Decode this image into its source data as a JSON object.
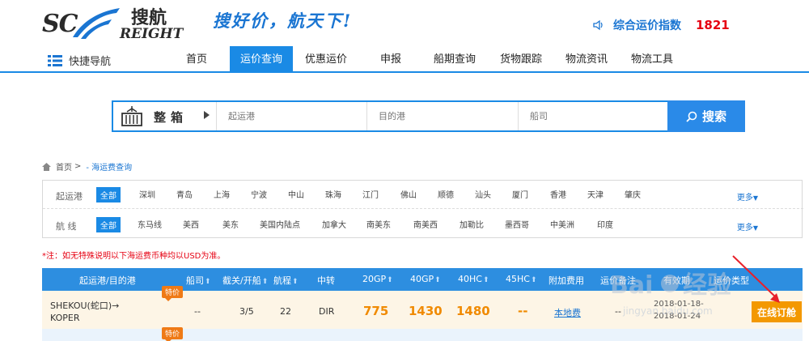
{
  "header": {
    "logo_main": "SC",
    "logo_cn": "搜航",
    "logo_sub": "REIGHT",
    "slogan": "搜好价，航天下!",
    "index_label": "综合运价指数",
    "index_value": "1821"
  },
  "nav": {
    "quick": "快捷导航",
    "items": [
      "首页",
      "运价查询",
      "优惠运价",
      "申报",
      "船期查询",
      "货物跟踪",
      "物流资讯",
      "物流工具"
    ],
    "active_index": 1
  },
  "search": {
    "type_label": "整箱",
    "origin_placeholder": "起运港",
    "dest_placeholder": "目的港",
    "carrier_placeholder": "船司",
    "button_label": "搜索"
  },
  "breadcrumb": {
    "home": "首页",
    "sep": ">",
    "current": "- 海运费查询"
  },
  "filters": {
    "origin": {
      "title": "起运港",
      "options": [
        "全部",
        "深圳",
        "青岛",
        "上海",
        "宁波",
        "中山",
        "珠海",
        "江门",
        "佛山",
        "顺德",
        "汕头",
        "厦门",
        "香港",
        "天津",
        "肇庆"
      ],
      "more": "更多"
    },
    "route": {
      "title": "航 线",
      "options": [
        "全部",
        "东马线",
        "美西",
        "美东",
        "美国内陆点",
        "加拿大",
        "南美东",
        "南美西",
        "加勒比",
        "墨西哥",
        "中美洲",
        "印度"
      ],
      "more": "更多"
    }
  },
  "note": "*注：如无特殊说明以下海运费币种均以USD为准。",
  "table": {
    "headers": [
      "起运港/目的港",
      "船司",
      "截关/开船",
      "航程",
      "中转",
      "20GP",
      "40GP",
      "40HC",
      "45HC",
      "附加费用",
      "运价备注",
      "有效期",
      "运价类型"
    ],
    "rows": [
      {
        "route_from": "SHEKOU(蛇口)→",
        "route_to": "KOPER",
        "tag": "特价",
        "carrier": "--",
        "cutoff": "3/5",
        "transit": "22",
        "via": "DIR",
        "gp20": "775",
        "gp40": "1430",
        "hc40": "1480",
        "hc45": "--",
        "surcharge": "本地费",
        "remark": "--",
        "valid_from": "2018-01-18-",
        "valid_to": "2018-01-24",
        "action": "在线订舱"
      }
    ],
    "row2_tag": "特价"
  },
  "watermark": {
    "brand": "Baidu经验",
    "url": "jingyan.baidu.com"
  },
  "colors": {
    "primary": "#1a8ae5",
    "brand_text": "#1a75d2",
    "alert": "#e60012",
    "price": "#f08a00",
    "order_button": "#f39800"
  }
}
